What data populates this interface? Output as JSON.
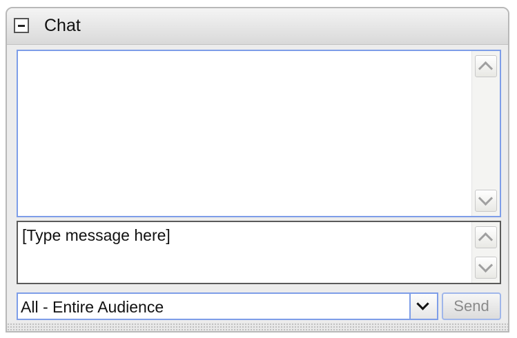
{
  "panel": {
    "title": "Chat",
    "collapse_icon": "minus-icon"
  },
  "history": {
    "messages": [],
    "scroll_up_icon": "chevron-up-icon",
    "scroll_down_icon": "chevron-down-icon"
  },
  "compose": {
    "value": "[Type message here]",
    "scroll_up_icon": "chevron-up-icon",
    "scroll_down_icon": "chevron-down-icon"
  },
  "audience": {
    "selected": "All - Entire Audience",
    "dropdown_icon": "chevron-down-icon"
  },
  "send": {
    "label": "Send"
  },
  "colors": {
    "focus_border": "#7d9de8",
    "panel_background": "#ececec",
    "send_text_disabled": "#8a8a8a"
  }
}
